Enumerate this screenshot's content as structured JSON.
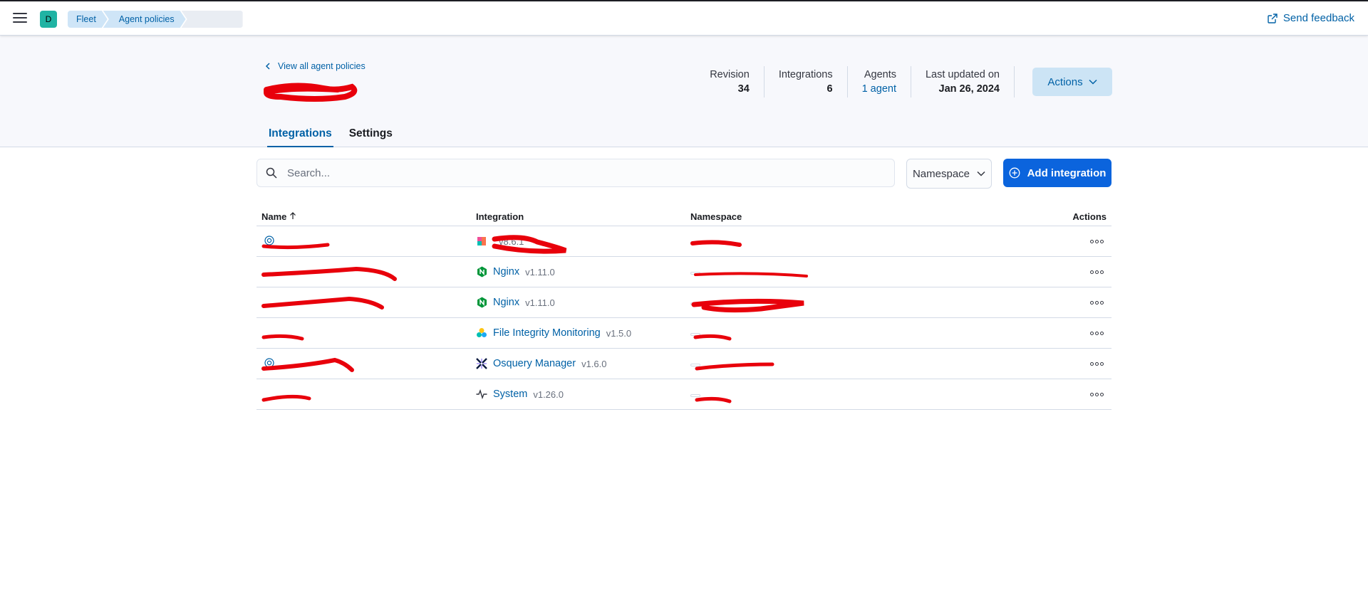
{
  "header": {
    "space_initial": "D",
    "breadcrumbs": [
      "Fleet",
      "Agent policies",
      "                "
    ],
    "send_feedback": "Send feedback"
  },
  "policy": {
    "back_link": "View all agent policies",
    "title": "                ",
    "stats": {
      "revision_label": "Revision",
      "revision_value": "34",
      "integrations_label": "Integrations",
      "integrations_value": "6",
      "agents_label": "Agents",
      "agents_value": "1 agent",
      "last_updated_label": "Last updated on",
      "last_updated_value": "Jan 26, 2024"
    },
    "actions_label": "Actions"
  },
  "tabs": [
    "Integrations",
    "Settings"
  ],
  "toolbar": {
    "search_placeholder": "Search...",
    "namespace_label": "Namespace",
    "add_integration_label": "Add integration"
  },
  "table": {
    "columns": [
      "Name",
      "Integration",
      "Namespace",
      "Actions"
    ],
    "rows": [
      {
        "name": "                ",
        "integration": "                ",
        "version": "v8.6.1",
        "namespace": "              ",
        "icon": "elastic-defend-icon"
      },
      {
        "name": "                                 ",
        "integration": "Nginx",
        "version": "v1.11.0",
        "namespace": "                              ",
        "icon": "nginx-icon"
      },
      {
        "name": "                               ",
        "integration": "Nginx",
        "version": "v1.11.0",
        "namespace": "                              ",
        "icon": "nginx-icon"
      },
      {
        "name": "          ",
        "integration": "File Integrity Monitoring",
        "version": "v1.5.0",
        "namespace": "          ",
        "icon": "file-integrity-icon"
      },
      {
        "name": "                           ",
        "integration": "Osquery Manager",
        "version": "v1.6.0",
        "namespace": "                     ",
        "icon": "osquery-icon"
      },
      {
        "name": "            ",
        "integration": "System",
        "version": "v1.26.0",
        "namespace": "          ",
        "icon": "system-icon"
      }
    ]
  }
}
